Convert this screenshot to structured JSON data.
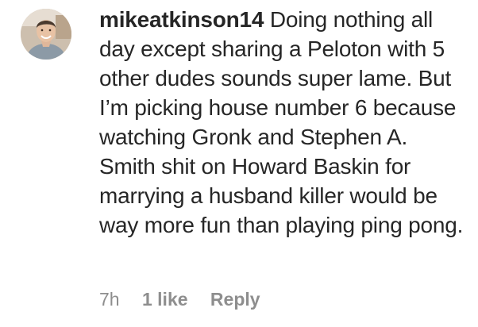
{
  "comment": {
    "username": "mikeatkinson14",
    "text": "Doing nothing all day except sharing a Peloton with 5 other dudes sounds super lame. But I’m picking house number 6 because watching Gronk and Stephen A. Smith shit on Howard Baskin for marrying a husband killer would be way more fun than playing ping pong.",
    "time": "7h",
    "likes": "1 like",
    "reply_label": "Reply"
  },
  "colors": {
    "text": "#262626",
    "meta": "#8e8e8e",
    "background": "#ffffff"
  },
  "icons": {
    "avatar": "user-profile-photo"
  }
}
